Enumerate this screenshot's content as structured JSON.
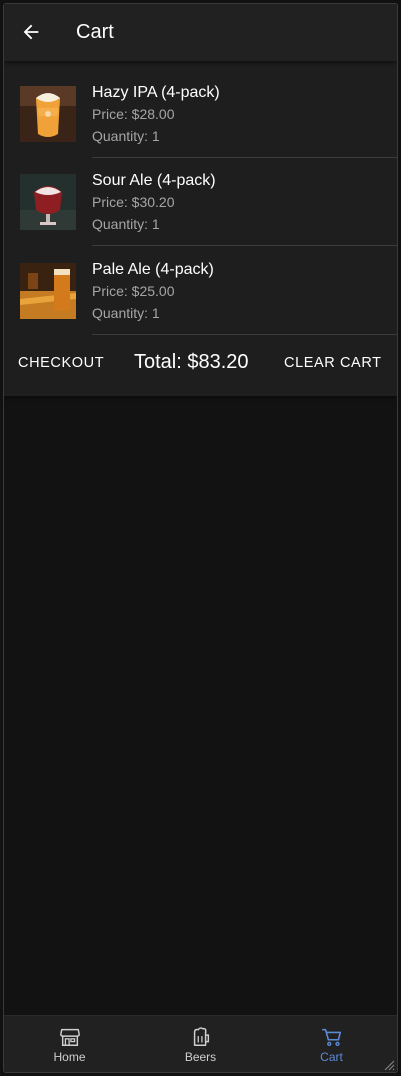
{
  "appbar": {
    "title": "Cart",
    "back_icon": "arrow-left-icon"
  },
  "cart": {
    "items": [
      {
        "name": "Hazy IPA (4-pack)",
        "price": "Price: $28.00",
        "quantity": "Quantity: 1"
      },
      {
        "name": "Sour Ale (4-pack)",
        "price": "Price: $30.20",
        "quantity": "Quantity: 1"
      },
      {
        "name": "Pale Ale (4-pack)",
        "price": "Price: $25.00",
        "quantity": "Quantity: 1"
      }
    ],
    "checkout_label": "CHECKOUT",
    "total_label": "Total: $83.20",
    "clear_label": "CLEAR CART"
  },
  "nav": {
    "items": [
      {
        "label": "Home",
        "icon": "storefront-icon",
        "active": false
      },
      {
        "label": "Beers",
        "icon": "beer-mug-icon",
        "active": false
      },
      {
        "label": "Cart",
        "icon": "cart-icon",
        "active": true
      }
    ]
  },
  "colors": {
    "background": "#121212",
    "surface": "#1e1e1e",
    "appbar": "#212121",
    "text_primary": "#ffffff",
    "text_secondary": "#a6a6a6",
    "nav_active": "#5c8bd6",
    "nav_inactive": "#cfcfcf"
  }
}
